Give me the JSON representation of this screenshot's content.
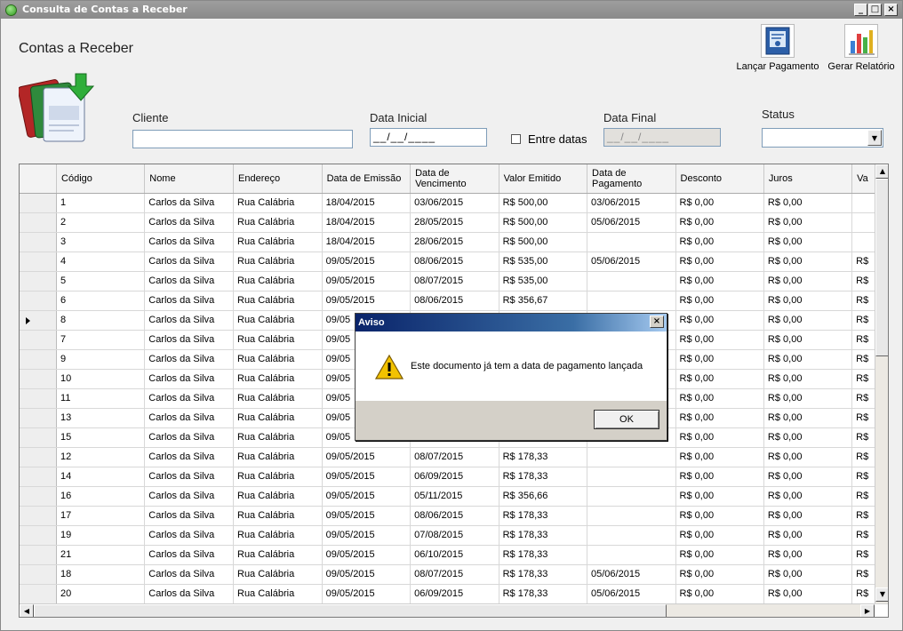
{
  "window": {
    "title": "Consulta de Contas a Receber"
  },
  "page": {
    "title": "Contas a Receber"
  },
  "toolbar": {
    "pay_label": "Lançar Pagamento",
    "report_label": "Gerar Relatório"
  },
  "filters": {
    "cliente_label": "Cliente",
    "cliente_value": "",
    "data_inicial_label": "Data Inicial",
    "data_inicial_value": "__/__/____",
    "entre_datas_label": "Entre datas",
    "entre_datas_checked": false,
    "data_final_label": "Data Final",
    "data_final_value": "__/__/____",
    "status_label": "Status",
    "status_value": ""
  },
  "grid": {
    "columns": [
      "Código",
      "Nome",
      "Endereço",
      "Data de Emissão",
      "Data de Vencimento",
      "Valor Emitido",
      "Data de Pagamento",
      "Desconto",
      "Juros",
      "Va"
    ],
    "selected_row_index": 6,
    "rows": [
      [
        "1",
        "Carlos da Silva",
        "Rua Calábria",
        "18/04/2015",
        "03/06/2015",
        "R$ 500,00",
        "03/06/2015",
        "R$ 0,00",
        "R$ 0,00",
        ""
      ],
      [
        "2",
        "Carlos da Silva",
        "Rua Calábria",
        "18/04/2015",
        "28/05/2015",
        "R$ 500,00",
        "05/06/2015",
        "R$ 0,00",
        "R$ 0,00",
        ""
      ],
      [
        "3",
        "Carlos da Silva",
        "Rua Calábria",
        "18/04/2015",
        "28/06/2015",
        "R$ 500,00",
        "",
        "R$ 0,00",
        "R$ 0,00",
        ""
      ],
      [
        "4",
        "Carlos da Silva",
        "Rua Calábria",
        "09/05/2015",
        "08/06/2015",
        "R$ 535,00",
        "05/06/2015",
        "R$ 0,00",
        "R$ 0,00",
        "R$"
      ],
      [
        "5",
        "Carlos da Silva",
        "Rua Calábria",
        "09/05/2015",
        "08/07/2015",
        "R$ 535,00",
        "",
        "R$ 0,00",
        "R$ 0,00",
        "R$"
      ],
      [
        "6",
        "Carlos da Silva",
        "Rua Calábria",
        "09/05/2015",
        "08/06/2015",
        "R$ 356,67",
        "",
        "R$ 0,00",
        "R$ 0,00",
        "R$"
      ],
      [
        "8",
        "Carlos da Silva",
        "Rua Calábria",
        "09/05",
        "",
        "",
        "",
        "R$ 0,00",
        "R$ 0,00",
        "R$"
      ],
      [
        "7",
        "Carlos da Silva",
        "Rua Calábria",
        "09/05",
        "",
        "",
        "",
        "R$ 0,00",
        "R$ 0,00",
        "R$"
      ],
      [
        "9",
        "Carlos da Silva",
        "Rua Calábria",
        "09/05",
        "",
        "",
        "",
        "R$ 0,00",
        "R$ 0,00",
        "R$"
      ],
      [
        "10",
        "Carlos da Silva",
        "Rua Calábria",
        "09/05",
        "",
        "",
        "",
        "R$ 0,00",
        "R$ 0,00",
        "R$"
      ],
      [
        "11",
        "Carlos da Silva",
        "Rua Calábria",
        "09/05",
        "",
        "",
        "",
        "R$ 0,00",
        "R$ 0,00",
        "R$"
      ],
      [
        "13",
        "Carlos da Silva",
        "Rua Calábria",
        "09/05",
        "",
        "",
        "",
        "R$ 0,00",
        "R$ 0,00",
        "R$"
      ],
      [
        "15",
        "Carlos da Silva",
        "Rua Calábria",
        "09/05",
        "",
        "",
        "",
        "R$ 0,00",
        "R$ 0,00",
        "R$"
      ],
      [
        "12",
        "Carlos da Silva",
        "Rua Calábria",
        "09/05/2015",
        "08/07/2015",
        "R$ 178,33",
        "",
        "R$ 0,00",
        "R$ 0,00",
        "R$"
      ],
      [
        "14",
        "Carlos da Silva",
        "Rua Calábria",
        "09/05/2015",
        "06/09/2015",
        "R$ 178,33",
        "",
        "R$ 0,00",
        "R$ 0,00",
        "R$"
      ],
      [
        "16",
        "Carlos da Silva",
        "Rua Calábria",
        "09/05/2015",
        "05/11/2015",
        "R$ 356,66",
        "",
        "R$ 0,00",
        "R$ 0,00",
        "R$"
      ],
      [
        "17",
        "Carlos da Silva",
        "Rua Calábria",
        "09/05/2015",
        "08/06/2015",
        "R$ 178,33",
        "",
        "R$ 0,00",
        "R$ 0,00",
        "R$"
      ],
      [
        "19",
        "Carlos da Silva",
        "Rua Calábria",
        "09/05/2015",
        "07/08/2015",
        "R$ 178,33",
        "",
        "R$ 0,00",
        "R$ 0,00",
        "R$"
      ],
      [
        "21",
        "Carlos da Silva",
        "Rua Calábria",
        "09/05/2015",
        "06/10/2015",
        "R$ 178,33",
        "",
        "R$ 0,00",
        "R$ 0,00",
        "R$"
      ],
      [
        "18",
        "Carlos da Silva",
        "Rua Calábria",
        "09/05/2015",
        "08/07/2015",
        "R$ 178,33",
        "05/06/2015",
        "R$ 0,00",
        "R$ 0,00",
        "R$"
      ],
      [
        "20",
        "Carlos da Silva",
        "Rua Calábria",
        "09/05/2015",
        "06/09/2015",
        "R$ 178,33",
        "05/06/2015",
        "R$ 0,00",
        "R$ 0,00",
        "R$"
      ]
    ]
  },
  "dialog": {
    "title": "Aviso",
    "message": "Este documento já tem a data de pagamento lançada",
    "ok_label": "OK"
  }
}
